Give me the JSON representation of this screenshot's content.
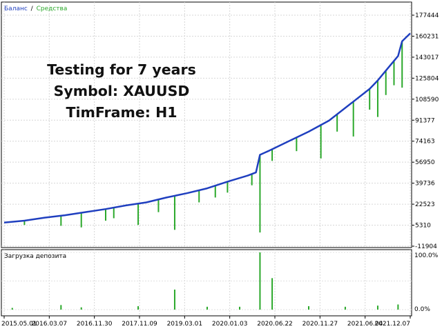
{
  "legend": {
    "balance_label": "Баланс",
    "separator": "/",
    "equity_label": "Средства",
    "balance_color": "#1f3fbf",
    "equity_color": "#2aa82a"
  },
  "overlay": {
    "line1": "Testing for 7 years",
    "line2": "Symbol: XAUUSD",
    "line3": "TimFrame: H1"
  },
  "subchart": {
    "title": "Загрузка депозита",
    "ylabels": [
      "100.0%",
      "0.0%"
    ]
  },
  "chart_data": [
    {
      "type": "line",
      "title": "",
      "ylim": [
        -11904,
        177444
      ],
      "yticks": [
        177444,
        160231,
        143017,
        125804,
        108590,
        91377,
        74163,
        56950,
        39736,
        22523,
        5310,
        -11904
      ],
      "ytick_labels": [
        "177444",
        "160231",
        "143017",
        "125804",
        "108590",
        "91377",
        "74163",
        "56950",
        "39736",
        "22523",
        "5310",
        "-11904"
      ],
      "xticks": [
        "2015.05.01",
        "2016.03.07",
        "2016.11.30",
        "2017.11.09",
        "2019.03.01",
        "2020.01.03",
        "2020.06.22",
        "2020.11.27",
        "2021.06.04",
        "2021.12.07"
      ],
      "grid": true,
      "series": [
        {
          "name": "Баланс",
          "color": "#1f3fbf",
          "x": [
            0,
            0.05,
            0.1,
            0.15,
            0.2,
            0.25,
            0.3,
            0.35,
            0.4,
            0.45,
            0.5,
            0.55,
            0.6,
            0.62,
            0.63,
            0.65,
            0.7,
            0.75,
            0.8,
            0.85,
            0.9,
            0.92,
            0.95,
            0.97,
            0.98,
            1.0
          ],
          "values": [
            7500,
            9000,
            11500,
            13500,
            16000,
            18500,
            21500,
            24000,
            28000,
            31500,
            35500,
            41000,
            46000,
            48500,
            63000,
            66000,
            74000,
            82000,
            91000,
            104000,
            117000,
            124000,
            136000,
            144000,
            156000,
            162500
          ]
        },
        {
          "name": "Средства",
          "color": "#2aa82a",
          "spikes": [
            {
              "x": 0.05,
              "value": 5500
            },
            {
              "x": 0.14,
              "value": 4800
            },
            {
              "x": 0.19,
              "value": 3500
            },
            {
              "x": 0.25,
              "value": 9000
            },
            {
              "x": 0.27,
              "value": 11000
            },
            {
              "x": 0.33,
              "value": 5500
            },
            {
              "x": 0.38,
              "value": 16000
            },
            {
              "x": 0.42,
              "value": 1500
            },
            {
              "x": 0.48,
              "value": 24000
            },
            {
              "x": 0.52,
              "value": 28000
            },
            {
              "x": 0.55,
              "value": 32000
            },
            {
              "x": 0.61,
              "value": 38000
            },
            {
              "x": 0.63,
              "value": -700
            },
            {
              "x": 0.66,
              "value": 58000
            },
            {
              "x": 0.72,
              "value": 66000
            },
            {
              "x": 0.78,
              "value": 60000
            },
            {
              "x": 0.82,
              "value": 82000
            },
            {
              "x": 0.86,
              "value": 78000
            },
            {
              "x": 0.9,
              "value": 100000
            },
            {
              "x": 0.92,
              "value": 94000
            },
            {
              "x": 0.94,
              "value": 112000
            },
            {
              "x": 0.96,
              "value": 120000
            },
            {
              "x": 0.98,
              "value": 118000
            }
          ]
        }
      ]
    },
    {
      "type": "bar",
      "title": "Загрузка депозита",
      "ylim": [
        0,
        100
      ],
      "yticks": [
        "100.0%",
        "0.0%"
      ],
      "series": [
        {
          "name": "Загрузка депозита",
          "color": "#2aa82a",
          "bars": [
            {
              "x": 0.02,
              "value": 3
            },
            {
              "x": 0.14,
              "value": 8
            },
            {
              "x": 0.19,
              "value": 4
            },
            {
              "x": 0.33,
              "value": 6
            },
            {
              "x": 0.42,
              "value": 35
            },
            {
              "x": 0.5,
              "value": 5
            },
            {
              "x": 0.58,
              "value": 5
            },
            {
              "x": 0.63,
              "value": 100
            },
            {
              "x": 0.66,
              "value": 55
            },
            {
              "x": 0.75,
              "value": 6
            },
            {
              "x": 0.84,
              "value": 5
            },
            {
              "x": 0.92,
              "value": 7
            },
            {
              "x": 0.97,
              "value": 9
            }
          ]
        }
      ]
    }
  ]
}
